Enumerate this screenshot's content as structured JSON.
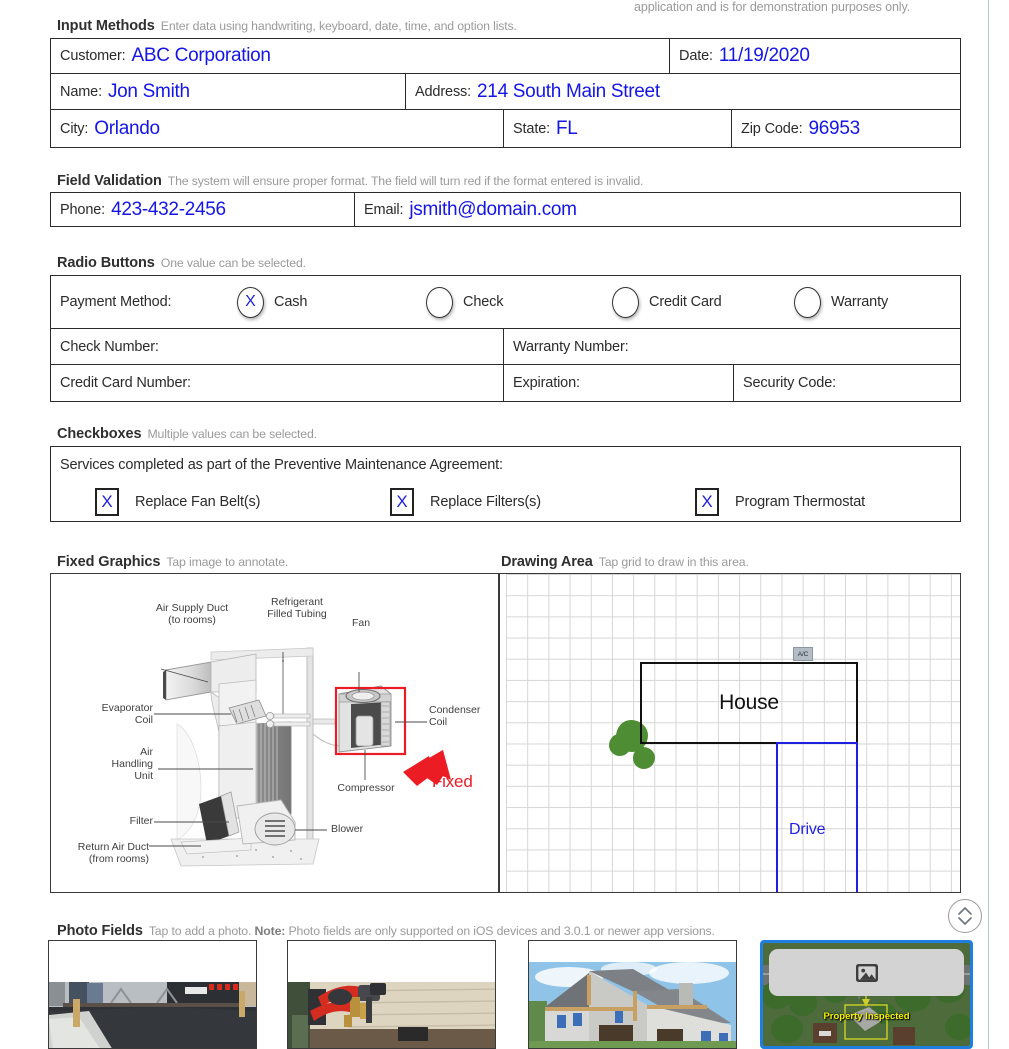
{
  "top_note": "application and is for demonstration purposes only.",
  "sections": {
    "input_methods": {
      "title": "Input Methods",
      "desc": "Enter data using handwriting, keyboard, date, time, and option lists.",
      "fields": {
        "customer_label": "Customer:",
        "customer_value": "ABC Corporation",
        "date_label": "Date:",
        "date_value": "11/19/2020",
        "name_label": "Name:",
        "name_value": "Jon Smith",
        "address_label": "Address:",
        "address_value": "214 South Main Street",
        "city_label": "City:",
        "city_value": "Orlando",
        "state_label": "State:",
        "state_value": "FL",
        "zip_label": "Zip Code:",
        "zip_value": "96953"
      }
    },
    "field_validation": {
      "title": "Field Validation",
      "desc": "The system will ensure proper format. The field will turn red if the format entered is invalid.",
      "fields": {
        "phone_label": "Phone:",
        "phone_value": "423-432-2456",
        "email_label": "Email:",
        "email_value": "jsmith@domain.com"
      }
    },
    "radio_buttons": {
      "title": "Radio Buttons",
      "desc": "One value can be selected.",
      "payment_label": "Payment Method:",
      "options": [
        {
          "label": "Cash",
          "mark": "X",
          "selected": true
        },
        {
          "label": "Check",
          "mark": "",
          "selected": false
        },
        {
          "label": "Credit Card",
          "mark": "",
          "selected": false
        },
        {
          "label": "Warranty",
          "mark": "",
          "selected": false
        }
      ],
      "check_number_label": "Check Number:",
      "check_number_value": "",
      "warranty_number_label": "Warranty Number:",
      "warranty_number_value": "",
      "credit_card_number_label": "Credit Card Number:",
      "credit_card_number_value": "",
      "expiration_label": "Expiration:",
      "expiration_value": "",
      "security_code_label": "Security Code:",
      "security_code_value": ""
    },
    "checkboxes": {
      "title": "Checkboxes",
      "desc": "Multiple values can be selected.",
      "prompt": "Services completed as part of the Preventive Maintenance Agreement:",
      "items": [
        {
          "label": "Replace Fan Belt(s)",
          "mark": "X",
          "checked": true
        },
        {
          "label": "Replace Filters(s)",
          "mark": "X",
          "checked": true
        },
        {
          "label": "Program Thermostat",
          "mark": "X",
          "checked": true
        }
      ]
    },
    "fixed_graphics": {
      "title": "Fixed Graphics",
      "desc": "Tap image to annotate.",
      "annotation": "Fixed",
      "diagram_labels": [
        "Air Supply Duct\n(to rooms)",
        "Refrigerant\nFilled Tubing",
        "Fan",
        "Condenser\nCoil",
        "Evaporator\nCoil",
        "Air\nHandling\nUnit",
        "Compressor",
        "Filter",
        "Blower",
        "Return Air Duct\n(from rooms)"
      ]
    },
    "drawing_area": {
      "title": "Drawing Area",
      "desc": "Tap grid to draw in this area.",
      "house_label": "House",
      "ac_label": "A/C",
      "drive_label": "Drive"
    },
    "photo_fields": {
      "title": "Photo Fields",
      "desc_1": "Tap to add a photo.",
      "desc_note": "Note:",
      "desc_2": "Photo fields are only supported on iOS devices and 3.0.1 or newer app versions.",
      "photos": [
        {
          "name": "asphalt-paving-photo",
          "caption": "",
          "selected": false
        },
        {
          "name": "spray-applicator-photo",
          "caption": "",
          "selected": false
        },
        {
          "name": "house-construction-photo",
          "caption": "",
          "selected": false
        },
        {
          "name": "aerial-property-photo",
          "caption": "Property Inspected",
          "selected": true
        }
      ]
    }
  },
  "controls": {
    "scroll_toggle": "scroll-up-down-button"
  },
  "colors": {
    "value_blue": "#1515e8",
    "accent_red": "#ec1c24",
    "selection_blue": "#1f7fe0",
    "caption_yellow": "#f5f500",
    "drive_blue": "#1f1fe0",
    "bush_green": "#4e8d34"
  }
}
